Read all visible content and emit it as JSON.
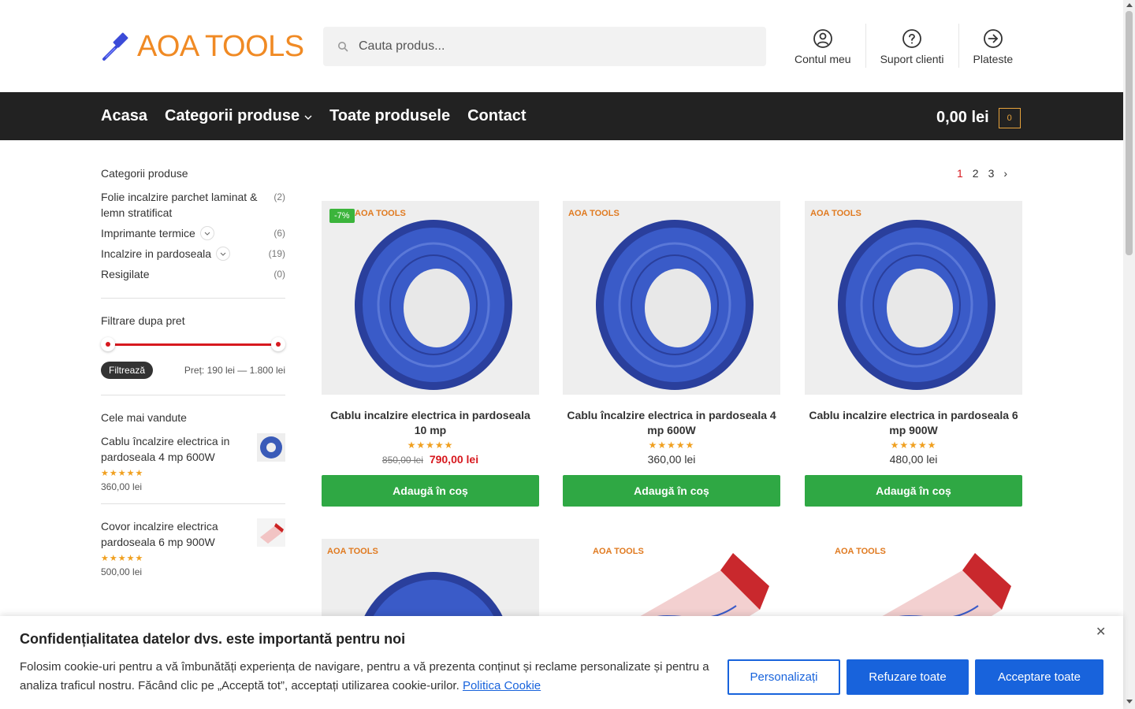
{
  "header": {
    "logo_text": "AOA TOOLS",
    "search_placeholder": "Cauta produs...",
    "links": [
      {
        "label": "Contul meu",
        "icon": "user-circle-icon"
      },
      {
        "label": "Suport clienti",
        "icon": "help-circle-icon"
      },
      {
        "label": "Plateste",
        "icon": "arrow-circle-icon"
      }
    ]
  },
  "nav": {
    "items": [
      "Acasa",
      "Categorii produse",
      "Toate produsele",
      "Contact"
    ],
    "cart_total": "0,00 lei",
    "cart_count": "0"
  },
  "sidebar": {
    "categories_title": "Categorii produse",
    "categories": [
      {
        "name": "Folie incalzire parchet laminat & lemn stratificat",
        "count": "(2)"
      },
      {
        "name": "Imprimante termice",
        "count": "(6)"
      },
      {
        "name": "Incalzire in pardoseala",
        "count": "(19)"
      },
      {
        "name": "Resigilate",
        "count": "(0)"
      }
    ],
    "filter_title": "Filtrare dupa pret",
    "filter_button": "Filtrează",
    "price_range": "Preț: 190 lei — 1.800 lei",
    "bestsellers_title": "Cele mai vandute",
    "bestsellers": [
      {
        "name": "Cablu încalzire electrica in pardoseala 4 mp 600W",
        "stars": "★★★★★",
        "price": "360,00 lei"
      },
      {
        "name": "Covor incalzire electrica pardoseala 6 mp 900W",
        "stars": "★★★★★",
        "price": "500,00 lei"
      }
    ]
  },
  "pagination": {
    "pages": [
      "1",
      "2",
      "3"
    ],
    "current": "1",
    "next": "›"
  },
  "products": [
    {
      "title": "Cablu incalzire electrica in pardoseala 10 mp",
      "badge": "-7%",
      "brand": "AOA TOOLS",
      "stars": "★★★★★",
      "old_price": "850,00 lei",
      "price": "790,00 lei",
      "button": "Adaugă în coș"
    },
    {
      "title": "Cablu încalzire electrica in pardoseala 4 mp 600W",
      "brand": "AOA TOOLS",
      "stars": "★★★★★",
      "price": "360,00 lei",
      "button": "Adaugă în coș"
    },
    {
      "title": "Cablu incalzire electrica in pardoseala 6 mp 900W",
      "brand": "AOA TOOLS",
      "stars": "★★★★★",
      "price": "480,00 lei",
      "button": "Adaugă în coș"
    },
    {
      "brand": "AOA TOOLS"
    },
    {
      "brand": "AOA TOOLS"
    },
    {
      "brand": "AOA TOOLS"
    }
  ],
  "cookie": {
    "title": "Confidențialitatea datelor dvs. este importantă pentru noi",
    "text": "Folosim cookie-uri pentru a vă îmbunătăți experiența de navigare, pentru a vă prezenta conținut și reclame personalizate și pentru a analiza traficul nostru. Făcând clic pe „Acceptă tot”, acceptați utilizarea cookie-urilor.",
    "link": "Politica Cookie",
    "customize": "Personalizați",
    "reject": "Refuzare toate",
    "accept": "Acceptare toate",
    "close": "✕"
  },
  "colors": {
    "brand_orange": "#f08a24",
    "nav_bg": "#222222",
    "sale_red": "#d7191f",
    "button_green": "#2fa844",
    "cookie_blue": "#1863dc"
  }
}
